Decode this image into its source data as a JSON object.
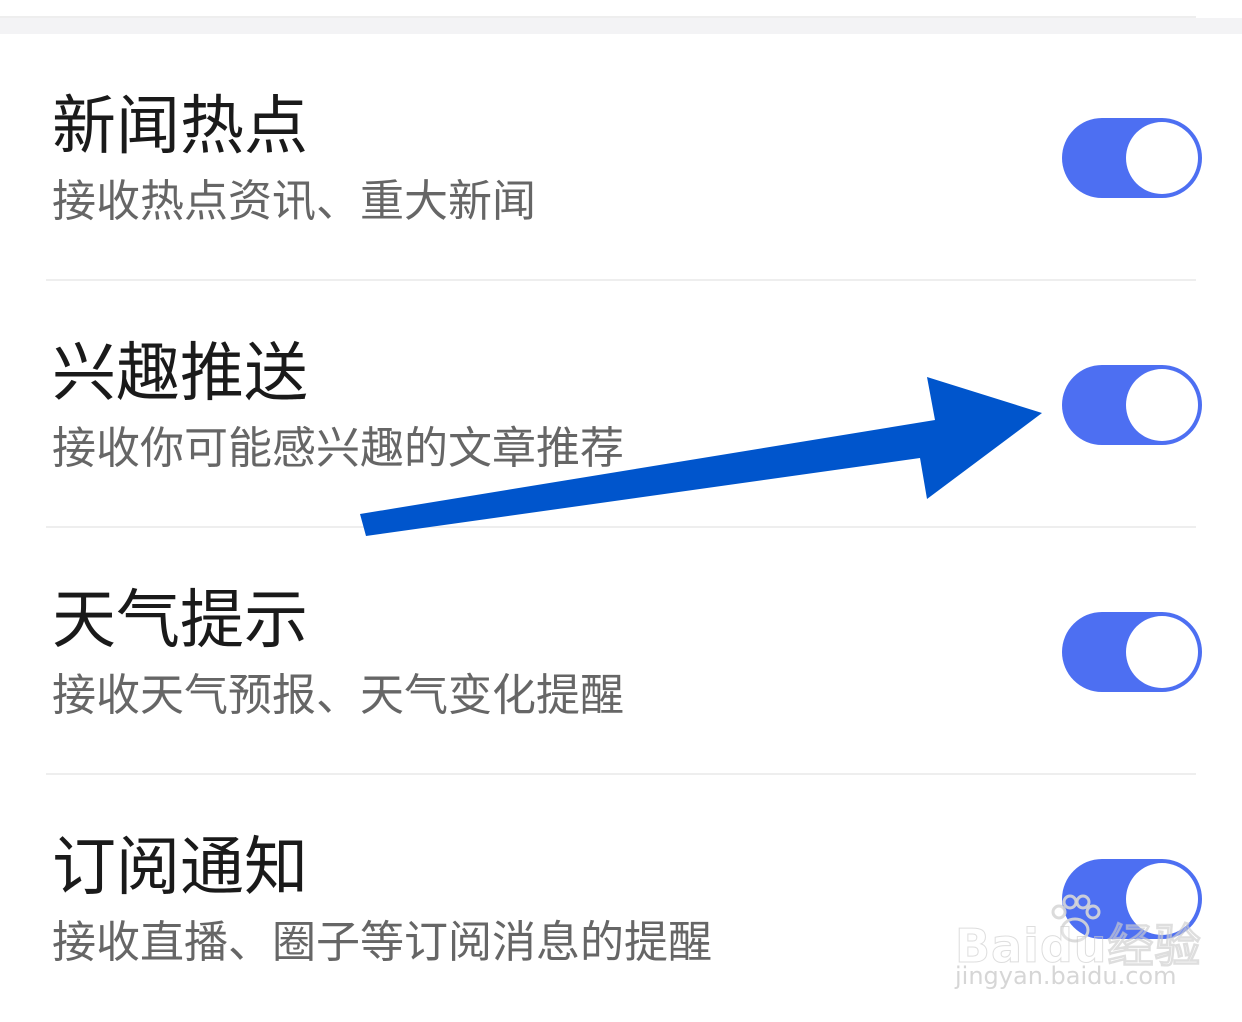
{
  "settings": [
    {
      "title": "新闻热点",
      "description": "接收热点资讯、重大新闻",
      "enabled": true
    },
    {
      "title": "兴趣推送",
      "description": "接收你可能感兴趣的文章推荐",
      "enabled": true
    },
    {
      "title": "天气提示",
      "description": "接收天气预报、天气变化提醒",
      "enabled": true
    },
    {
      "title": "订阅通知",
      "description": "接收直播、圈子等订阅消息的提醒",
      "enabled": true
    }
  ],
  "colors": {
    "toggle_on": "#4d6ff2",
    "arrow": "#0055cc",
    "title_text": "#1a1a1a",
    "desc_text": "#666666"
  },
  "annotation": {
    "icon": "arrow-icon",
    "points_to": "兴趣推送"
  },
  "watermark": {
    "brand": "Baidu经验",
    "domain": "jingyan.baidu.com"
  }
}
